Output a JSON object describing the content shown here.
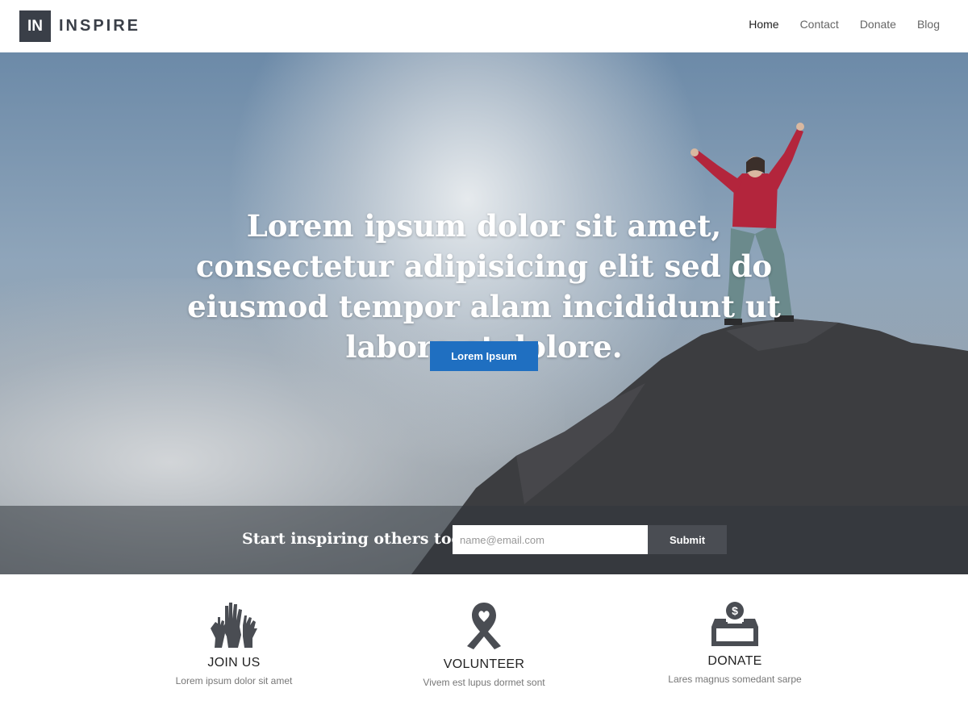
{
  "brand": {
    "logo_mark": "IN",
    "name": "INSPIRE"
  },
  "nav": {
    "items": [
      {
        "label": "Home",
        "active": true
      },
      {
        "label": "Contact",
        "active": false
      },
      {
        "label": "Donate",
        "active": false
      },
      {
        "label": "Blog",
        "active": false
      }
    ]
  },
  "hero": {
    "headline": "Lorem ipsum dolor sit amet, consectetur adipisicing elit sed do eiusmod tempor alam incididunt ut labore et dolore.",
    "cta_label": "Lorem Ipsum"
  },
  "signup": {
    "label": "Start inspiring others today!",
    "email_placeholder": "name@email.com",
    "submit_label": "Submit"
  },
  "features": [
    {
      "icon": "raised-hands-icon",
      "title": "JOIN US",
      "description": "Lorem ipsum dolor sit amet"
    },
    {
      "icon": "ribbon-heart-icon",
      "title": "VOLUNTEER",
      "description": "Vivem est lupus dormet sont"
    },
    {
      "icon": "donation-box-icon",
      "title": "DONATE",
      "description": "Lares magnus somedant sarpe"
    }
  ],
  "colors": {
    "accent": "#1f6fc1",
    "dark": "#3a3f48",
    "icon": "#4a4d53"
  }
}
